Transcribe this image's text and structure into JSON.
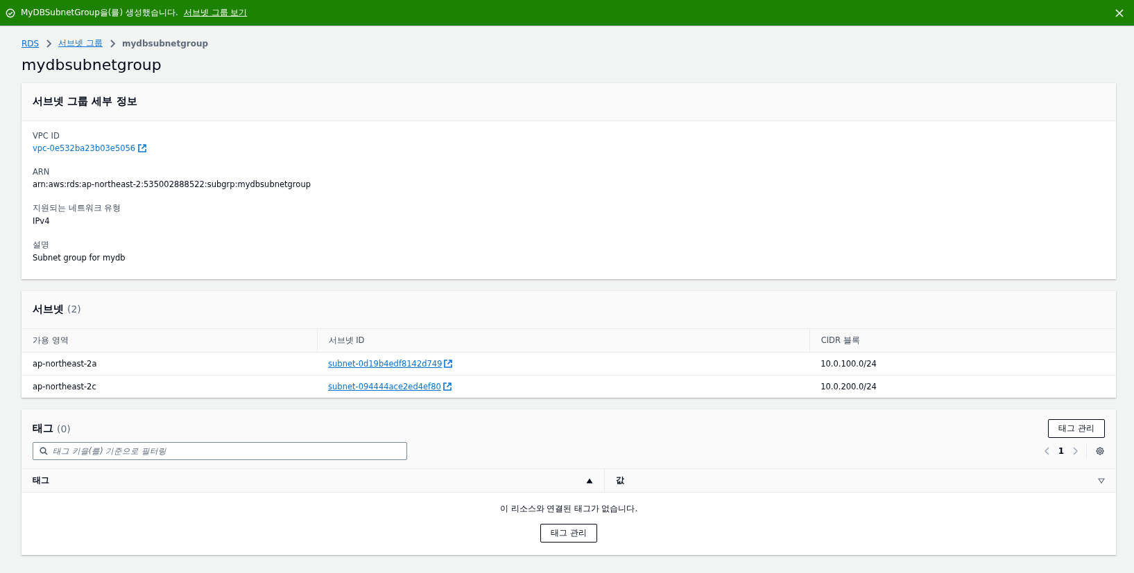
{
  "flash": {
    "message": "MyDBSubnetGroup을(를) 생성했습니다.",
    "link": "서브넷 그룹 보기"
  },
  "breadcrumbs": [
    {
      "label": "RDS",
      "link": true
    },
    {
      "label": "서브넷 그룹",
      "link": true
    },
    {
      "label": "mydbsubnetgroup",
      "link": false
    }
  ],
  "page_title": "mydbsubnetgroup",
  "details": {
    "title": "서브넷 그룹 세부 정보",
    "fields": [
      {
        "label": "VPC ID",
        "value": "vpc-0e532ba23b03e5056",
        "kind": "external-link"
      },
      {
        "label": "ARN",
        "value": "arn:aws:rds:ap-northeast-2:535002888522:subgrp:mydbsubnetgroup",
        "kind": "text"
      },
      {
        "label": "지원되는 네트워크 유형",
        "value": "IPv4",
        "kind": "text"
      },
      {
        "label": "설명",
        "value": "Subnet group for mydb",
        "kind": "text"
      }
    ]
  },
  "subnets": {
    "title": "서브넷",
    "count": "(2)",
    "columns": [
      "가용 영역",
      "서브넷 ID",
      "CIDR 블록"
    ],
    "rows": [
      {
        "zone": "ap-northeast-2a",
        "subnet_id": "subnet-0d19b4edf8142d749",
        "cidr": "10.0.100.0/24"
      },
      {
        "zone": "ap-northeast-2c",
        "subnet_id": "subnet-094444ace2ed4ef80",
        "cidr": "10.0.200.0/24"
      }
    ]
  },
  "tags": {
    "title": "태그",
    "count": "(0)",
    "manage_button": "태그 관리",
    "filter": {
      "placeholder": "태그 키을(를) 기준으로 필터링"
    },
    "page": "1",
    "columns": [
      {
        "label": "태그",
        "sorted": true
      },
      {
        "label": "값",
        "sorted": false
      }
    ],
    "empty_message": "이 리소스와 연결된 태그가 없습니다.",
    "empty_button": "태그 관리"
  }
}
